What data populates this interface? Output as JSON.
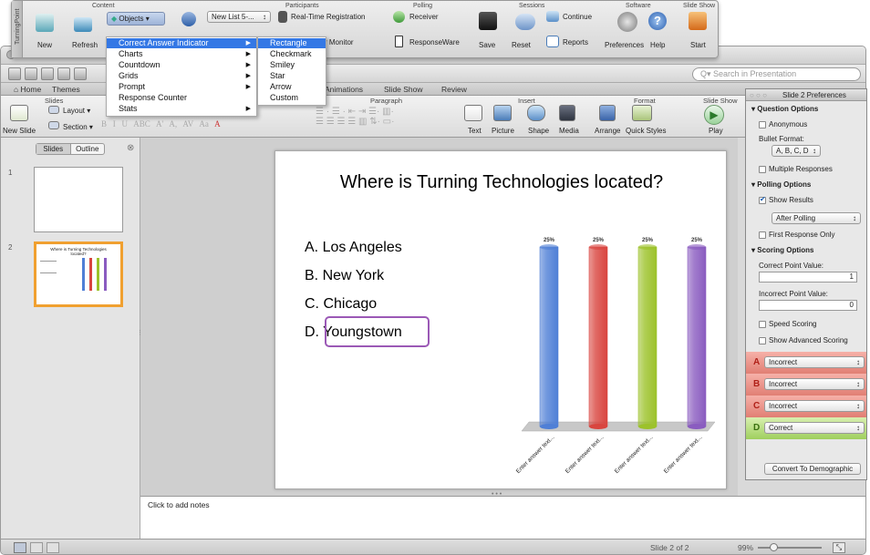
{
  "turningpoint": {
    "side_label": "TurningPoint",
    "groups": {
      "content": "Content",
      "participants": "Participants",
      "polling": "Polling",
      "sessions": "Sessions",
      "software": "Software",
      "slideshow": "Slide Show"
    },
    "new_label": "New",
    "refresh_label": "Refresh",
    "objects_label": "Objects",
    "list_select": "New List 5-...",
    "realtime_label": "Real-Time Registration",
    "monitor_label": "r Monitor",
    "receiver_label": "Receiver",
    "responseware_label": "ResponseWare",
    "save_label": "Save",
    "reset_label": "Reset",
    "continue_label": "Continue",
    "reports_label": "Reports",
    "preferences_label": "Preferences",
    "help_label": "Help",
    "start_label": "Start"
  },
  "menu": {
    "items": [
      "Correct Answer Indicator",
      "Charts",
      "Countdown",
      "Grids",
      "Prompt",
      "Response Counter",
      "Stats"
    ],
    "submenu": [
      "Rectangle",
      "Checkmark",
      "Smiley",
      "Star",
      "Arrow",
      "Custom"
    ]
  },
  "search": {
    "placeholder": "Search in Presentation"
  },
  "ribbon": {
    "tabs": [
      "Home",
      "Themes",
      "Animations",
      "Slide Show",
      "Review"
    ],
    "groups": {
      "slides": "Slides",
      "paragraph": "Paragraph",
      "insert": "Insert",
      "format": "Format",
      "slideshow": "Slide Show"
    },
    "new_slide": "New Slide",
    "layout": "Layout",
    "section": "Section",
    "text": "Text",
    "picture": "Picture",
    "shape": "Shape",
    "media": "Media",
    "arrange": "Arrange",
    "quick_styles": "Quick Styles",
    "play": "Play"
  },
  "leftpane": {
    "tab_slides": "Slides",
    "tab_outline": "Outline",
    "slide1_num": "1",
    "slide2_num": "2",
    "thumb_title": "Where is Turning Technologies located?"
  },
  "slide": {
    "title": "Where is Turning Technologies located?",
    "answers": [
      "A.  Los Angeles",
      "B.  New York",
      "C.  Chicago",
      "D.  Youngstown"
    ]
  },
  "chart_data": {
    "type": "bar",
    "categories": [
      "Enter answer text...",
      "Enter answer text...",
      "Enter answer text...",
      "Enter answer text..."
    ],
    "values": [
      25,
      25,
      25,
      25
    ],
    "data_labels": [
      "25%",
      "25%",
      "25%",
      "25%"
    ],
    "ylim": [
      0,
      25
    ],
    "colors": [
      "#4f7fd6",
      "#d9453f",
      "#9cc22a",
      "#8a5cc0"
    ]
  },
  "notes": {
    "placeholder": "Click to add notes"
  },
  "status": {
    "slide_indicator": "Slide 2 of 2",
    "zoom": "99%"
  },
  "prefs": {
    "title": "Slide 2 Preferences",
    "question_options": "Question Options",
    "anonymous": "Anonymous",
    "bullet_format_label": "Bullet Format:",
    "bullet_format": "A, B, C, D",
    "multiple_responses": "Multiple Responses",
    "polling_options": "Polling Options",
    "show_results": "Show Results",
    "after_polling": "After Polling",
    "first_response_only": "First Response Only",
    "scoring_options": "Scoring Options",
    "correct_point_label": "Correct Point Value:",
    "correct_point": "1",
    "incorrect_point_label": "Incorrect Point Value:",
    "incorrect_point": "0",
    "speed_scoring": "Speed Scoring",
    "show_advanced": "Show Advanced Scoring",
    "answers": [
      {
        "letter": "A",
        "value": "Incorrect"
      },
      {
        "letter": "B",
        "value": "Incorrect"
      },
      {
        "letter": "C",
        "value": "Incorrect"
      },
      {
        "letter": "D",
        "value": "Correct"
      }
    ],
    "convert_button": "Convert To Demographic"
  }
}
